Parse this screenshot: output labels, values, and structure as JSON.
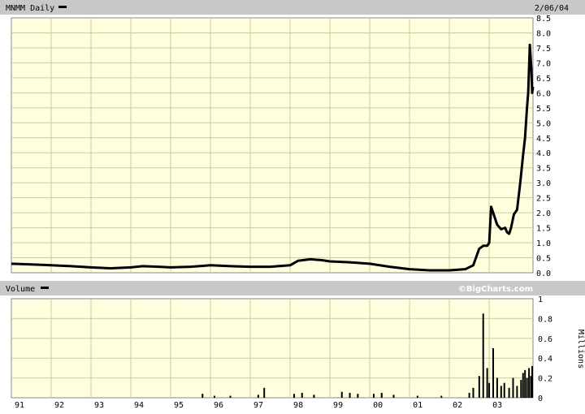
{
  "header": {
    "symbol": "MNMM Daily",
    "date": "2/06/04"
  },
  "volume_panel": {
    "label": "Volume",
    "unit_label": "Millions",
    "watermark": "©BigCharts.com"
  },
  "colors": {
    "band": "#c8c8c8",
    "plot": "#ffffe0",
    "grid": "#cccc99",
    "price": "#000000"
  },
  "chart_data": [
    {
      "type": "line",
      "name": "price",
      "x_categories": [
        "91",
        "92",
        "93",
        "94",
        "95",
        "96",
        "97",
        "98",
        "99",
        "00",
        "01",
        "02",
        "03"
      ],
      "ylim": [
        0,
        8.5
      ],
      "y_ticks": [
        "0.0",
        "0.5",
        "1.0",
        "1.5",
        "2.0",
        "2.5",
        "3.0",
        "3.5",
        "4.0",
        "4.5",
        "5.0",
        "5.5",
        "6.0",
        "6.5",
        "7.0",
        "7.5",
        "8.0",
        "8.5"
      ],
      "grid": true,
      "series": [
        {
          "x": [
            1991.0,
            1991.5,
            1992.0,
            1992.5,
            1993.0,
            1993.5,
            1994.0,
            1994.3,
            1994.7,
            1995.0,
            1995.5,
            1996.0,
            1996.5,
            1997.0,
            1997.5,
            1998.0,
            1998.2,
            1998.5,
            1998.8,
            1999.0,
            1999.5,
            2000.0,
            2000.5,
            2001.0,
            2001.5,
            2002.0,
            2002.4,
            2002.6,
            2002.75,
            2002.85,
            2002.95,
            2003.0,
            2003.05,
            2003.1,
            2003.2,
            2003.3,
            2003.4,
            2003.45,
            2003.5,
            2003.55,
            2003.62,
            2003.7,
            2003.78,
            2003.85,
            2003.9,
            2003.95,
            2003.98,
            2004.02,
            2004.06,
            2004.08,
            2004.1
          ],
          "y": [
            0.3,
            0.28,
            0.25,
            0.22,
            0.18,
            0.15,
            0.18,
            0.22,
            0.2,
            0.18,
            0.2,
            0.25,
            0.22,
            0.2,
            0.2,
            0.25,
            0.4,
            0.45,
            0.42,
            0.38,
            0.35,
            0.3,
            0.2,
            0.12,
            0.08,
            0.08,
            0.12,
            0.25,
            0.8,
            0.9,
            0.9,
            1.0,
            2.2,
            2.0,
            1.6,
            1.45,
            1.5,
            1.35,
            1.3,
            1.5,
            1.95,
            2.1,
            3.0,
            3.9,
            4.5,
            5.5,
            6.0,
            7.6,
            6.8,
            6.0,
            6.2
          ]
        }
      ]
    },
    {
      "type": "bar",
      "name": "volume",
      "x_categories": [
        "91",
        "92",
        "93",
        "94",
        "95",
        "96",
        "97",
        "98",
        "99",
        "00",
        "01",
        "02",
        "03"
      ],
      "ylim": [
        0,
        1
      ],
      "y_ticks": [
        "1",
        "0.8",
        "0.6",
        "0.4",
        "0.2",
        "0"
      ],
      "ylabel": "Millions",
      "series": [
        {
          "x": [
            1995.8,
            1996.1,
            1996.5,
            1997.2,
            1997.35,
            1998.1,
            1998.3,
            1998.6,
            1999.3,
            1999.5,
            1999.7,
            2000.1,
            2000.3,
            2000.6,
            2001.2,
            2001.8,
            2002.5,
            2002.6,
            2002.75,
            2002.85,
            2002.95,
            2003.0,
            2003.1,
            2003.2,
            2003.3,
            2003.38,
            2003.5,
            2003.6,
            2003.7,
            2003.8,
            2003.85,
            2003.9,
            2003.95,
            2004.0,
            2004.05,
            2004.08
          ],
          "y": [
            0.04,
            0.02,
            0.02,
            0.03,
            0.1,
            0.04,
            0.05,
            0.03,
            0.06,
            0.05,
            0.04,
            0.04,
            0.05,
            0.03,
            0.02,
            0.02,
            0.05,
            0.1,
            0.22,
            0.85,
            0.3,
            0.15,
            0.5,
            0.2,
            0.12,
            0.15,
            0.1,
            0.2,
            0.12,
            0.18,
            0.25,
            0.28,
            0.2,
            0.3,
            0.22,
            0.32
          ]
        }
      ]
    }
  ]
}
